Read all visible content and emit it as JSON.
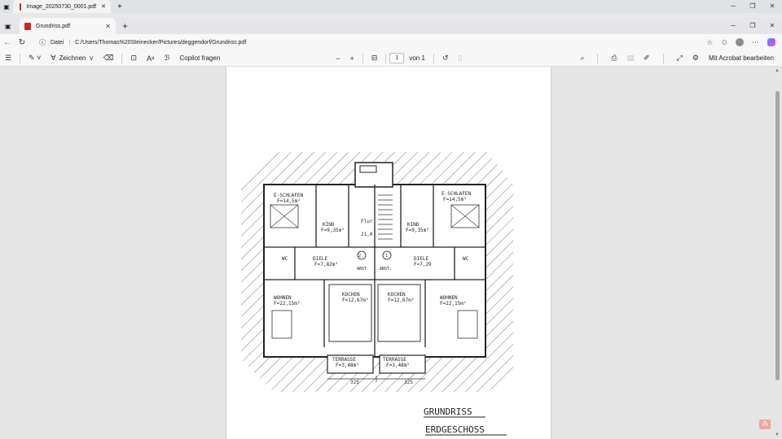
{
  "background_window": {
    "tab_title": "Image_20250730_0001.pdf"
  },
  "tab": {
    "title": "Grundriss.pdf"
  },
  "address": {
    "prefix": "Datei",
    "url": "C:/Users/Thomas%20Steinecker/Pictures/deggendorf/Grundriss.pdf"
  },
  "toolbar": {
    "draw_label": "Zeichnen",
    "copilot_label": "Copilot fragen",
    "page_current": "1",
    "page_total": "von 1",
    "acrobat_label": "Mit Acrobat bearbeiten"
  },
  "drawing": {
    "title_line1": "GRUNDRISS",
    "title_line2": "ERDGESCHOSS",
    "rooms": {
      "eschlafen_left": "E-SCHLAFEN",
      "eschlafen_left_area": "F=14,5m²",
      "eschlafen_right": "E-SCHLAFEN",
      "eschlafen_right_area": "F=14,5m²",
      "kind_left": "KIND",
      "kind_left_area": "F=9,35m²",
      "kind_right": "KIND",
      "kind_right_area": "F=9,35m²",
      "diele_left": "DIELE",
      "diele_left_area": "F=7,82m²",
      "diele_right": "DIELE",
      "diele_right_area": "F=7,29",
      "wc_left": "WC",
      "wc_right": "WC",
      "wohnen_left": "WOHNEN",
      "wohnen_left_area": "F=22,15m²",
      "wohnen_right": "WOHNEN",
      "wohnen_right_area": "F=22,15m²",
      "kochen_left": "KOCHEN",
      "kochen_left_area": "F=12,67m²",
      "kochen_right": "KOCHEN",
      "kochen_right_area": "F=12,67m²",
      "abst_left": "ABST.",
      "abst_right": "ABST.",
      "terrasse_left": "TERRASSE",
      "terrasse_left_area": "F=3,48m²",
      "terrasse_right": "TERRASSE",
      "terrasse_right_area": "F=3,48m²",
      "flur_label": "Flur",
      "flur_area": "21,0",
      "unit_1": "1",
      "unit_2": "2",
      "dim_left": "325",
      "dim_right": "325"
    }
  }
}
